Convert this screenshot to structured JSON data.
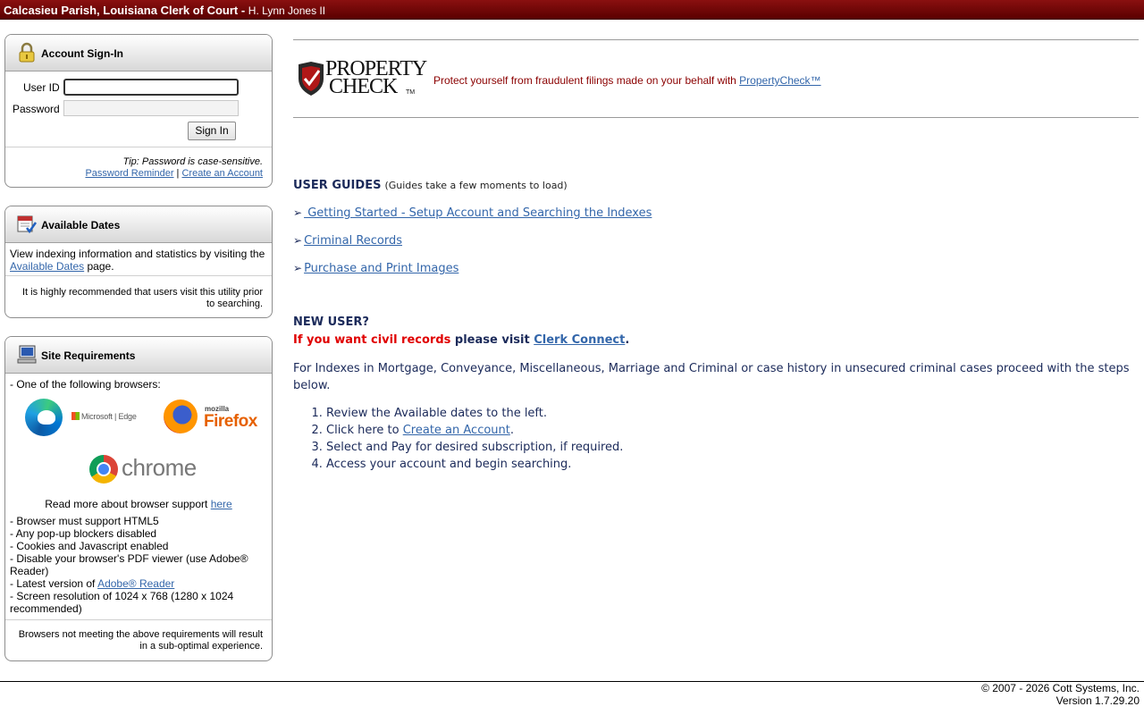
{
  "header": {
    "title": "Calcasieu Parish, Louisiana Clerk of Court - ",
    "clerk_name": "H. Lynn Jones II"
  },
  "signin": {
    "title": "Account Sign-In",
    "userid_label": "User ID",
    "password_label": "Password",
    "signin_button": "Sign In",
    "tip": "Tip: Password is case-sensitive.",
    "password_reminder": "Password Reminder",
    "separator": " | ",
    "create_account": "Create an Account"
  },
  "available_dates": {
    "title": "Available Dates",
    "text_before": "View indexing information and statistics by visiting the ",
    "link": "Available Dates",
    "text_after": " page.",
    "note": "It is highly recommended that users visit this utility prior to searching."
  },
  "site_requirements": {
    "title": "Site Requirements",
    "browsers_intro": "- One of the following browsers:",
    "edge_brand": "Microsoft | Edge",
    "firefox_small": "mozilla",
    "firefox_brand": "Firefox",
    "chrome_brand": "chrome",
    "read_more": "Read more about browser support ",
    "here_link": "here",
    "req_1": "- Browser must support HTML5",
    "req_2": "- Any pop-up blockers disabled",
    "req_3": "- Cookies and Javascript enabled",
    "req_4": "- Disable your browser's PDF viewer (use Adobe® Reader)",
    "req_5_before": "- Latest version of ",
    "req_5_link": "Adobe® Reader",
    "req_6": "- Screen resolution of 1024 x 768 (1280 x 1024 recommended)",
    "note": "Browsers not meeting the above requirements will result in a sub-optimal experience."
  },
  "propertycheck": {
    "logo_line1": "PROPERTY",
    "logo_line2": "CHECK",
    "logo_tm": "TM",
    "text": "Protect yourself from fraudulent filings made on your behalf with ",
    "link": "PropertyCheck™"
  },
  "guides": {
    "title": "USER GUIDES",
    "note": "(Guides take a few moments to load)",
    "items": [
      " Getting Started - Setup Account and Searching the Indexes",
      "Criminal Records",
      "Purchase and Print Images"
    ]
  },
  "new_user": {
    "title": "NEW USER?",
    "civil_red": "If you want civil records",
    "civil_text": " please visit ",
    "civil_link": "Clerk Connect",
    "civil_end": ".",
    "intro": "For Indexes in Mortgage, Conveyance, Miscellaneous, Marriage and Criminal or case history in unsecured criminal cases proceed with the steps below.",
    "step1": "Review the Available dates to the left.",
    "step2_before": "Click here to ",
    "step2_link": "Create an Account",
    "step2_after": ".",
    "step3": "Select and Pay for desired subscription, if required.",
    "step4": "Access your account and begin searching."
  },
  "footer": {
    "copyright": "© 2007 - 2026 Cott Systems, Inc.",
    "version": "Version 1.7.29.20"
  }
}
